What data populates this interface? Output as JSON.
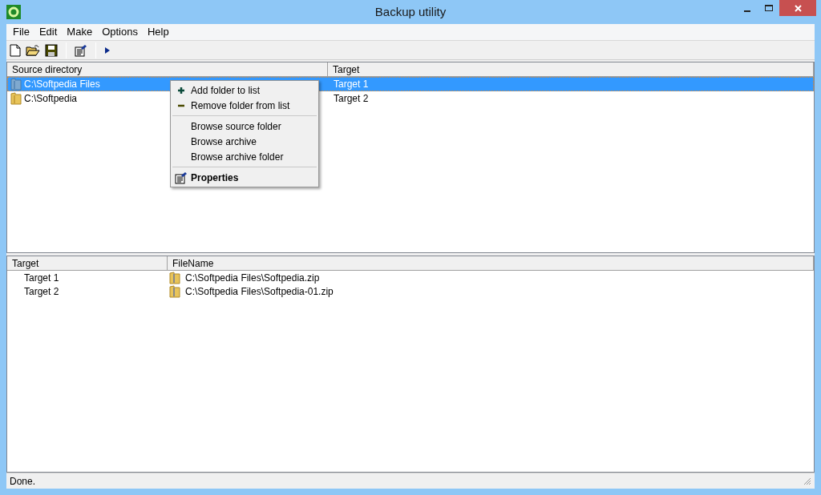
{
  "window": {
    "title": "Backup utility"
  },
  "menu_bar": [
    "File",
    "Edit",
    "Make",
    "Options",
    "Help"
  ],
  "toolbar": [
    {
      "kind": "new"
    },
    {
      "kind": "open"
    },
    {
      "kind": "save"
    },
    {
      "kind": "separator"
    },
    {
      "kind": "properties"
    },
    {
      "kind": "separator"
    },
    {
      "kind": "run"
    }
  ],
  "sources": {
    "columns": [
      "Source directory",
      "Target"
    ],
    "rows": [
      {
        "source": "C:\\Softpedia Files",
        "target": "Target 1",
        "selected": true
      },
      {
        "source": "C:\\Softpedia",
        "target": "Target 2",
        "selected": false
      }
    ]
  },
  "context_menu": {
    "groups": [
      [
        {
          "label": "Add folder to list",
          "kind": "plus",
          "bold": false
        },
        {
          "label": "Remove folder from list",
          "kind": "minus",
          "bold": false
        }
      ],
      [
        {
          "label": "Browse source folder",
          "kind": "plain",
          "bold": false
        },
        {
          "label": "Browse archive",
          "kind": "plain",
          "bold": false
        },
        {
          "label": "Browse archive folder",
          "kind": "plain",
          "bold": false
        }
      ],
      [
        {
          "label": "Properties",
          "kind": "properties",
          "bold": true
        }
      ]
    ]
  },
  "archives": {
    "columns": [
      "Target",
      "FileName"
    ],
    "rows": [
      {
        "target": "Target 1",
        "file": "C:\\Softpedia Files\\Softpedia.zip"
      },
      {
        "target": "Target 2",
        "file": "C:\\Softpedia Files\\Softpedia-01.zip"
      }
    ]
  },
  "status_bar": "Done."
}
